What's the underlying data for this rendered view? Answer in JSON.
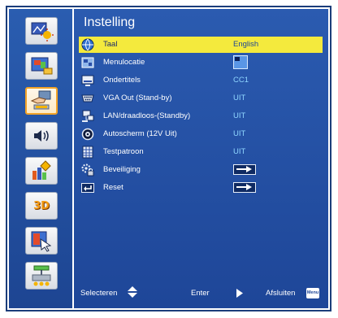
{
  "menu": {
    "title": "Instelling",
    "selected_index": 0,
    "items": [
      {
        "label": "Taal",
        "value": "English",
        "icon": "globe-icon",
        "value_kind": "text"
      },
      {
        "label": "Menulocatie",
        "value": "",
        "icon": "menu-location-icon",
        "value_kind": "position-icon"
      },
      {
        "label": "Ondertitels",
        "value": "CC1",
        "icon": "subtitles-icon",
        "value_kind": "text"
      },
      {
        "label": "VGA Out (Stand-by)",
        "value": "UIT",
        "icon": "vga-port-icon",
        "value_kind": "text"
      },
      {
        "label": "LAN/draadloos-(Standby)",
        "value": "UIT",
        "icon": "network-icon",
        "value_kind": "text"
      },
      {
        "label": "Autoscherm (12V Uit)",
        "value": "UIT",
        "icon": "auto-screen-icon",
        "value_kind": "text"
      },
      {
        "label": "Testpatroon",
        "value": "UIT",
        "icon": "test-pattern-icon",
        "value_kind": "text"
      },
      {
        "label": "Beveiliging",
        "value": "",
        "icon": "lock-gear-icon",
        "value_kind": "enter-arrow"
      },
      {
        "label": "Reset",
        "value": "",
        "icon": "reset-icon",
        "value_kind": "enter-arrow"
      }
    ]
  },
  "sidebar": {
    "active_index": 2,
    "tabs": [
      {
        "name": "image-tab",
        "icon": "image-settings-icon"
      },
      {
        "name": "display-tab",
        "icon": "display-settings-icon"
      },
      {
        "name": "setup-tab",
        "icon": "setup-hand-icon"
      },
      {
        "name": "audio-tab",
        "icon": "speaker-icon"
      },
      {
        "name": "options-tab",
        "icon": "options-chart-icon"
      },
      {
        "name": "3d-tab",
        "icon": "3d-icon",
        "text": "3D"
      },
      {
        "name": "info-tab",
        "icon": "info-pointer-icon"
      },
      {
        "name": "network-tab",
        "icon": "lan-icon"
      }
    ]
  },
  "footer": {
    "select_label": "Selecteren",
    "enter_label": "Enter",
    "exit_label": "Afsluiten",
    "menu_key": "Menu"
  },
  "colors": {
    "panel_top": "#2b5bb0",
    "panel_bottom": "#1e4698",
    "highlight": "#f4ea3d",
    "value_text": "#8fd6ff",
    "active_tab_border": "#f2a227"
  }
}
